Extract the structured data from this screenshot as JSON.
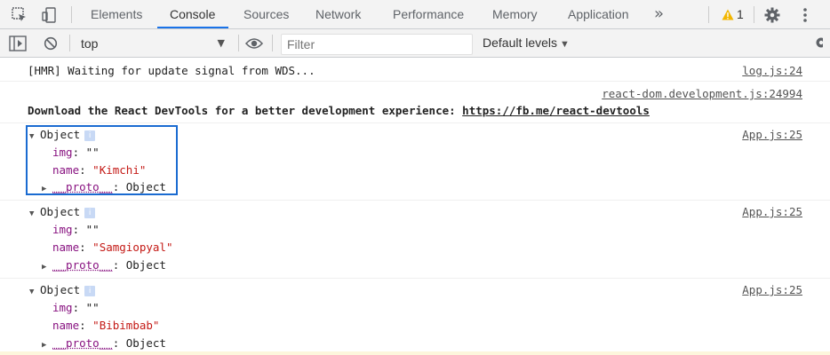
{
  "tabs": {
    "items": [
      {
        "label": "Elements"
      },
      {
        "label": "Console"
      },
      {
        "label": "Sources"
      },
      {
        "label": "Network"
      },
      {
        "label": "Performance"
      },
      {
        "label": "Memory"
      },
      {
        "label": "Application"
      }
    ],
    "active": "Console",
    "more": "»",
    "warning_count": "1"
  },
  "toolbar": {
    "context": "top",
    "filter_placeholder": "Filter",
    "levels": "Default levels"
  },
  "messages": [
    {
      "text": "[HMR] Waiting for update signal from WDS...",
      "source": "log.js:24"
    },
    {
      "source": "react-dom.development.js:24994",
      "text": "Download the React DevTools for a better development experience: ",
      "link": "https://fb.me/react-devtools"
    },
    {
      "source": "App.js:25",
      "header": "Object",
      "img_key": "img",
      "img_val": "\"\"",
      "name_key": "name",
      "name_val": "\"Kimchi\"",
      "proto": "__proto__",
      "proto_val": ": Object"
    },
    {
      "source": "App.js:25",
      "header": "Object",
      "img_key": "img",
      "img_val": "\"\"",
      "name_key": "name",
      "name_val": "\"Samgiopyal\"",
      "proto": "__proto__",
      "proto_val": ": Object"
    },
    {
      "source": "App.js:25",
      "header": "Object",
      "img_key": "img",
      "img_val": "\"\"",
      "name_key": "name",
      "name_val": "\"Bibimbab\"",
      "proto": "__proto__",
      "proto_val": ": Object"
    }
  ],
  "colors": {
    "accent": "#1a73e8",
    "highlight_border": "#1a6bd1",
    "key": "#881280",
    "string": "#c41a16",
    "warning": "#f2b600"
  },
  "icons": [
    "inspect-icon",
    "device-toggle-icon",
    "warning-icon",
    "settings-gear-icon",
    "more-vert-icon",
    "sidebar-toggle-icon",
    "clear-console-icon",
    "eye-icon",
    "console-settings-icon"
  ]
}
